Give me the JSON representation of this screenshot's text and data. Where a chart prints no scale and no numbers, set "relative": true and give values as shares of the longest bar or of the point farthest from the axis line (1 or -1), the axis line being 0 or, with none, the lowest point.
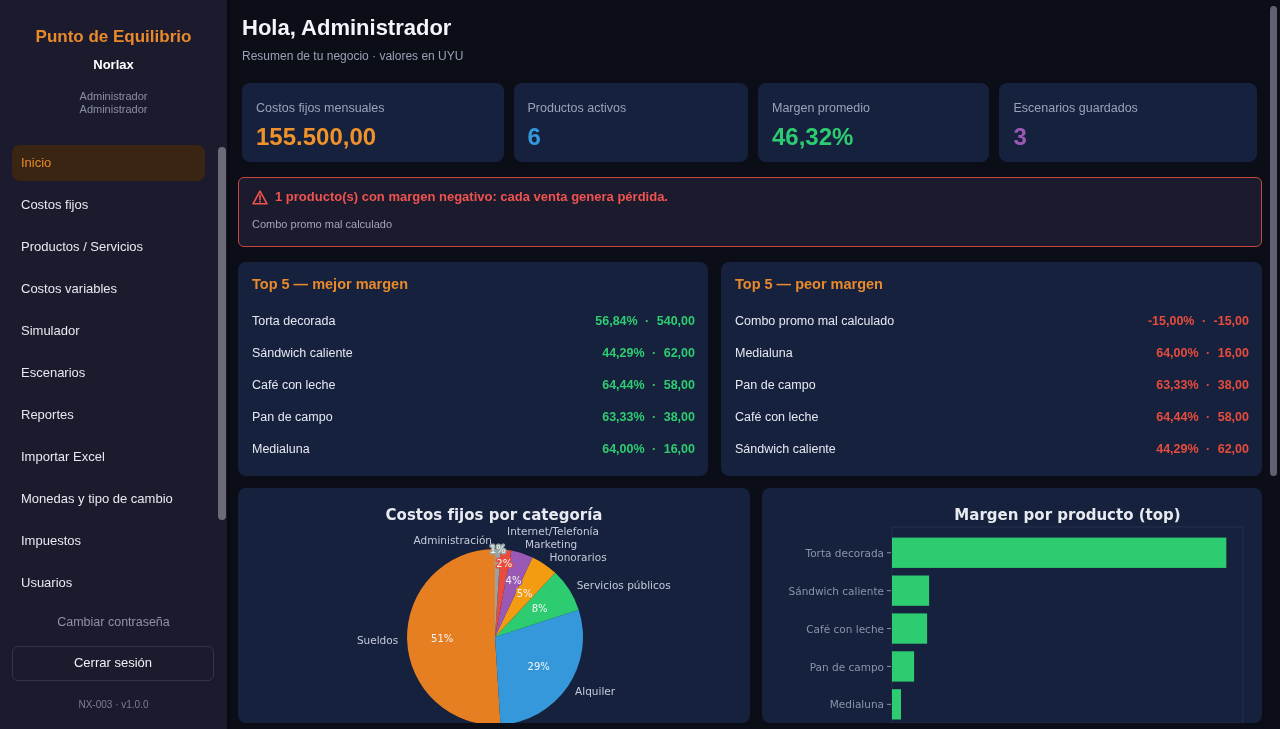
{
  "sidebar": {
    "brand": "Punto de Equilibrio",
    "company": "Norlax",
    "user_name": "Administrador",
    "role": "Administrador",
    "nav_items": [
      {
        "label": "Inicio",
        "selected": true
      },
      {
        "label": "Costos fijos",
        "selected": false
      },
      {
        "label": "Productos / Servicios",
        "selected": false
      },
      {
        "label": "Costos variables",
        "selected": false
      },
      {
        "label": "Simulador",
        "selected": false
      },
      {
        "label": "Escenarios",
        "selected": false
      },
      {
        "label": "Reportes",
        "selected": false
      },
      {
        "label": "Importar Excel",
        "selected": false
      },
      {
        "label": "Monedas y tipo de cambio",
        "selected": false
      },
      {
        "label": "Impuestos",
        "selected": false
      },
      {
        "label": "Usuarios",
        "selected": false
      }
    ],
    "change_password_link": "Cambiar contraseña",
    "logout_button": "Cerrar sesión",
    "version": "NX-003 · v1.0.0"
  },
  "header": {
    "title": "Hola, Administrador",
    "subtitle": "Resumen de tu negocio · valores en UYU"
  },
  "stat_cards": [
    {
      "label": "Costos fijos mensuales",
      "value": "155.500,00",
      "color": "#f0922b"
    },
    {
      "label": "Productos activos",
      "value": "6",
      "color": "#3498db"
    },
    {
      "label": "Margen promedio",
      "value": "46,32%",
      "color": "#2ecc71"
    },
    {
      "label": "Escenarios guardados",
      "value": "3",
      "color": "#9b59b6"
    }
  ],
  "alert": {
    "message": "1 producto(s) con margen negativo: cada venta genera pérdida.",
    "details": "Combo promo mal calculado"
  },
  "rankings": [
    {
      "title": "Top 5 — mejor margen",
      "color": "#2ecc71",
      "rows": [
        {
          "name": "Torta decorada",
          "figures": "56,84% · 540,00"
        },
        {
          "name": "Sándwich caliente",
          "figures": "44,29% · 62,00"
        },
        {
          "name": "Café con leche",
          "figures": "64,44% · 58,00"
        },
        {
          "name": "Pan de campo",
          "figures": "63,33% · 38,00"
        },
        {
          "name": "Medialuna",
          "figures": "64,00% · 16,00"
        }
      ]
    },
    {
      "title": "Top 5 — peor margen",
      "color": "#e74c3c",
      "rows": [
        {
          "name": "Combo promo mal calculado",
          "figures": "-15,00% · -15,00"
        },
        {
          "name": "Medialuna",
          "figures": "64,00% · 16,00"
        },
        {
          "name": "Pan de campo",
          "figures": "63,33% · 38,00"
        },
        {
          "name": "Café con leche",
          "figures": "64,44% · 58,00"
        },
        {
          "name": "Sándwich caliente",
          "figures": "44,29% · 62,00"
        }
      ]
    }
  ],
  "charts": [
    {
      "chart_data": {
        "type": "pie",
        "title": "Costos fijos por categoría",
        "categories": [
          "Sueldos",
          "Alquiler",
          "Servicios públicos",
          "Honorarios",
          "Marketing",
          "Internet/Telefonía",
          "Administración"
        ],
        "values": [
          51,
          29,
          8,
          5,
          4,
          2,
          1
        ],
        "colors": [
          "#e67e22",
          "#3498db",
          "#2ecc71",
          "#f39c12",
          "#9b59b6",
          "#e74c3c",
          "#95a5a6"
        ],
        "value_labels": [
          "51%",
          "29%",
          "8%",
          "5%",
          "4%",
          "2%",
          "1%"
        ]
      }
    },
    {
      "chart_data": {
        "type": "bar",
        "orientation": "horizontal",
        "relative": true,
        "title": "Margen por producto (top)",
        "categories": [
          "Torta decorada",
          "Sándwich caliente",
          "Café con leche",
          "Pan de campo",
          "Medialuna"
        ],
        "series": [
          {
            "color": "#2ecc71",
            "values": [
              1,
              0.111,
              0.105,
              0.066,
              0.027
            ]
          }
        ]
      }
    }
  ]
}
